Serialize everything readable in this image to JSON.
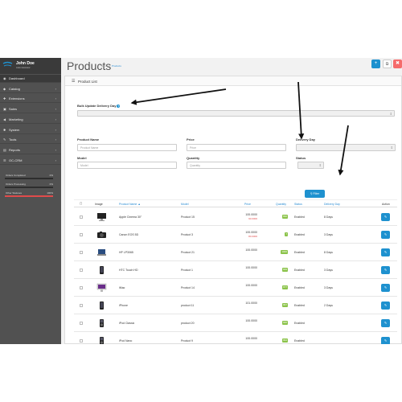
{
  "profile": {
    "name": "John Doe",
    "role": "Administrator"
  },
  "sidebar": {
    "items": [
      {
        "label": "Dashboard",
        "icon": "dashboard-icon",
        "glyph": "◉",
        "active": true
      },
      {
        "label": "Catalog",
        "icon": "tag-icon",
        "glyph": "◆",
        "chevron": "›"
      },
      {
        "label": "Extensions",
        "icon": "puzzle-icon",
        "glyph": "✚",
        "chevron": "›"
      },
      {
        "label": "Sales",
        "icon": "cart-icon",
        "glyph": "▣",
        "chevron": "›"
      },
      {
        "label": "Marketing",
        "icon": "share-icon",
        "glyph": "◀",
        "chevron": "›"
      },
      {
        "label": "System",
        "icon": "gear-icon",
        "glyph": "✱",
        "chevron": "›"
      },
      {
        "label": "Tools",
        "icon": "wrench-icon",
        "glyph": "✎",
        "chevron": "›"
      },
      {
        "label": "Reports",
        "icon": "chart-icon",
        "glyph": "▤",
        "chevron": "›"
      },
      {
        "label": "OC-CRM",
        "icon": "crm-icon",
        "glyph": "☰",
        "chevron": "›"
      }
    ],
    "stats": [
      {
        "label": "Orders Completed",
        "value": "0%",
        "fraction": 0,
        "color": "green"
      },
      {
        "label": "Orders Processing",
        "value": "0%",
        "fraction": 0,
        "color": "red"
      },
      {
        "label": "Other Statuses",
        "value": "100%",
        "fraction": 1,
        "color": "red"
      }
    ]
  },
  "header": {
    "title": "Products",
    "breadcrumb": [
      "Home",
      "Products"
    ],
    "buttons": {
      "add": "+",
      "copy": "⧉",
      "delete": "✖"
    }
  },
  "panel": {
    "title": "Product List",
    "bulk_label": "Bulk Update Delivery Day",
    "bulk_help": "?"
  },
  "filters": {
    "product_name": {
      "label": "Product Name",
      "placeholder": "Product Name"
    },
    "price": {
      "label": "Price",
      "placeholder": "Price"
    },
    "delivery_day": {
      "label": "Delivery Day"
    },
    "model": {
      "label": "Model",
      "placeholder": "Model"
    },
    "quantity": {
      "label": "Quantity",
      "placeholder": "Quantity"
    },
    "status": {
      "label": "Status"
    },
    "filter_button": "⚲ Filter"
  },
  "table": {
    "columns": {
      "image": "Image",
      "name": "Product Name ▲",
      "model": "Model",
      "price": "Price",
      "quantity": "Quantity",
      "status": "Status",
      "delivery": "Delivery Day",
      "action": "Action"
    },
    "rows": [
      {
        "name": "Apple Cinema 30\"",
        "model": "Product 15",
        "price": "100.0000",
        "special": "90.0000",
        "qty": "990",
        "qty_color": "green",
        "status": "Enabled",
        "delivery": "8 Days",
        "thumb": "monitor"
      },
      {
        "name": "Canon EOS 5D",
        "model": "Product 3",
        "price": "100.0000",
        "special": "80.0000",
        "qty": "7",
        "qty_color": "green",
        "status": "Enabled",
        "delivery": "3 Days",
        "thumb": "camera"
      },
      {
        "name": "HP LP3065",
        "model": "Product 21",
        "price": "100.0000",
        "special": "",
        "qty": "1000",
        "qty_color": "green",
        "status": "Enabled",
        "delivery": "8 Days",
        "thumb": "laptop"
      },
      {
        "name": "HTC Touch HD",
        "model": "Product 1",
        "price": "100.0000",
        "special": "",
        "qty": "939",
        "qty_color": "green",
        "status": "Enabled",
        "delivery": "3 Days",
        "thumb": "phone"
      },
      {
        "name": "iMac",
        "model": "Product 14",
        "price": "100.0000",
        "special": "",
        "qty": "977",
        "qty_color": "green",
        "status": "Enabled",
        "delivery": "3 Days",
        "thumb": "imac"
      },
      {
        "name": "iPhone",
        "model": "product 11",
        "price": "101.0000",
        "special": "",
        "qty": "967",
        "qty_color": "green",
        "status": "Enabled",
        "delivery": "2 Days",
        "thumb": "phone"
      },
      {
        "name": "iPod Classic",
        "model": "product 20",
        "price": "100.0000",
        "special": "",
        "qty": "995",
        "qty_color": "green",
        "status": "Enabled",
        "delivery": "",
        "thumb": "ipod"
      },
      {
        "name": "iPod Nano",
        "model": "Product 9",
        "price": "100.0000",
        "special": "",
        "qty": "994",
        "qty_color": "green",
        "status": "Enabled",
        "delivery": "",
        "thumb": "ipod"
      },
      {
        "name": "iPod Shuffle",
        "model": "Product 7",
        "price": "100.0000",
        "special": "",
        "qty": "995",
        "qty_color": "green",
        "status": "Enabled",
        "delivery": "",
        "thumb": "shuffle"
      }
    ]
  },
  "colors": {
    "accent": "#1e91cf",
    "sidebar": "#515151",
    "danger": "#f56b6b",
    "qty_green": "#8bc34a",
    "arrows": "#111111"
  }
}
